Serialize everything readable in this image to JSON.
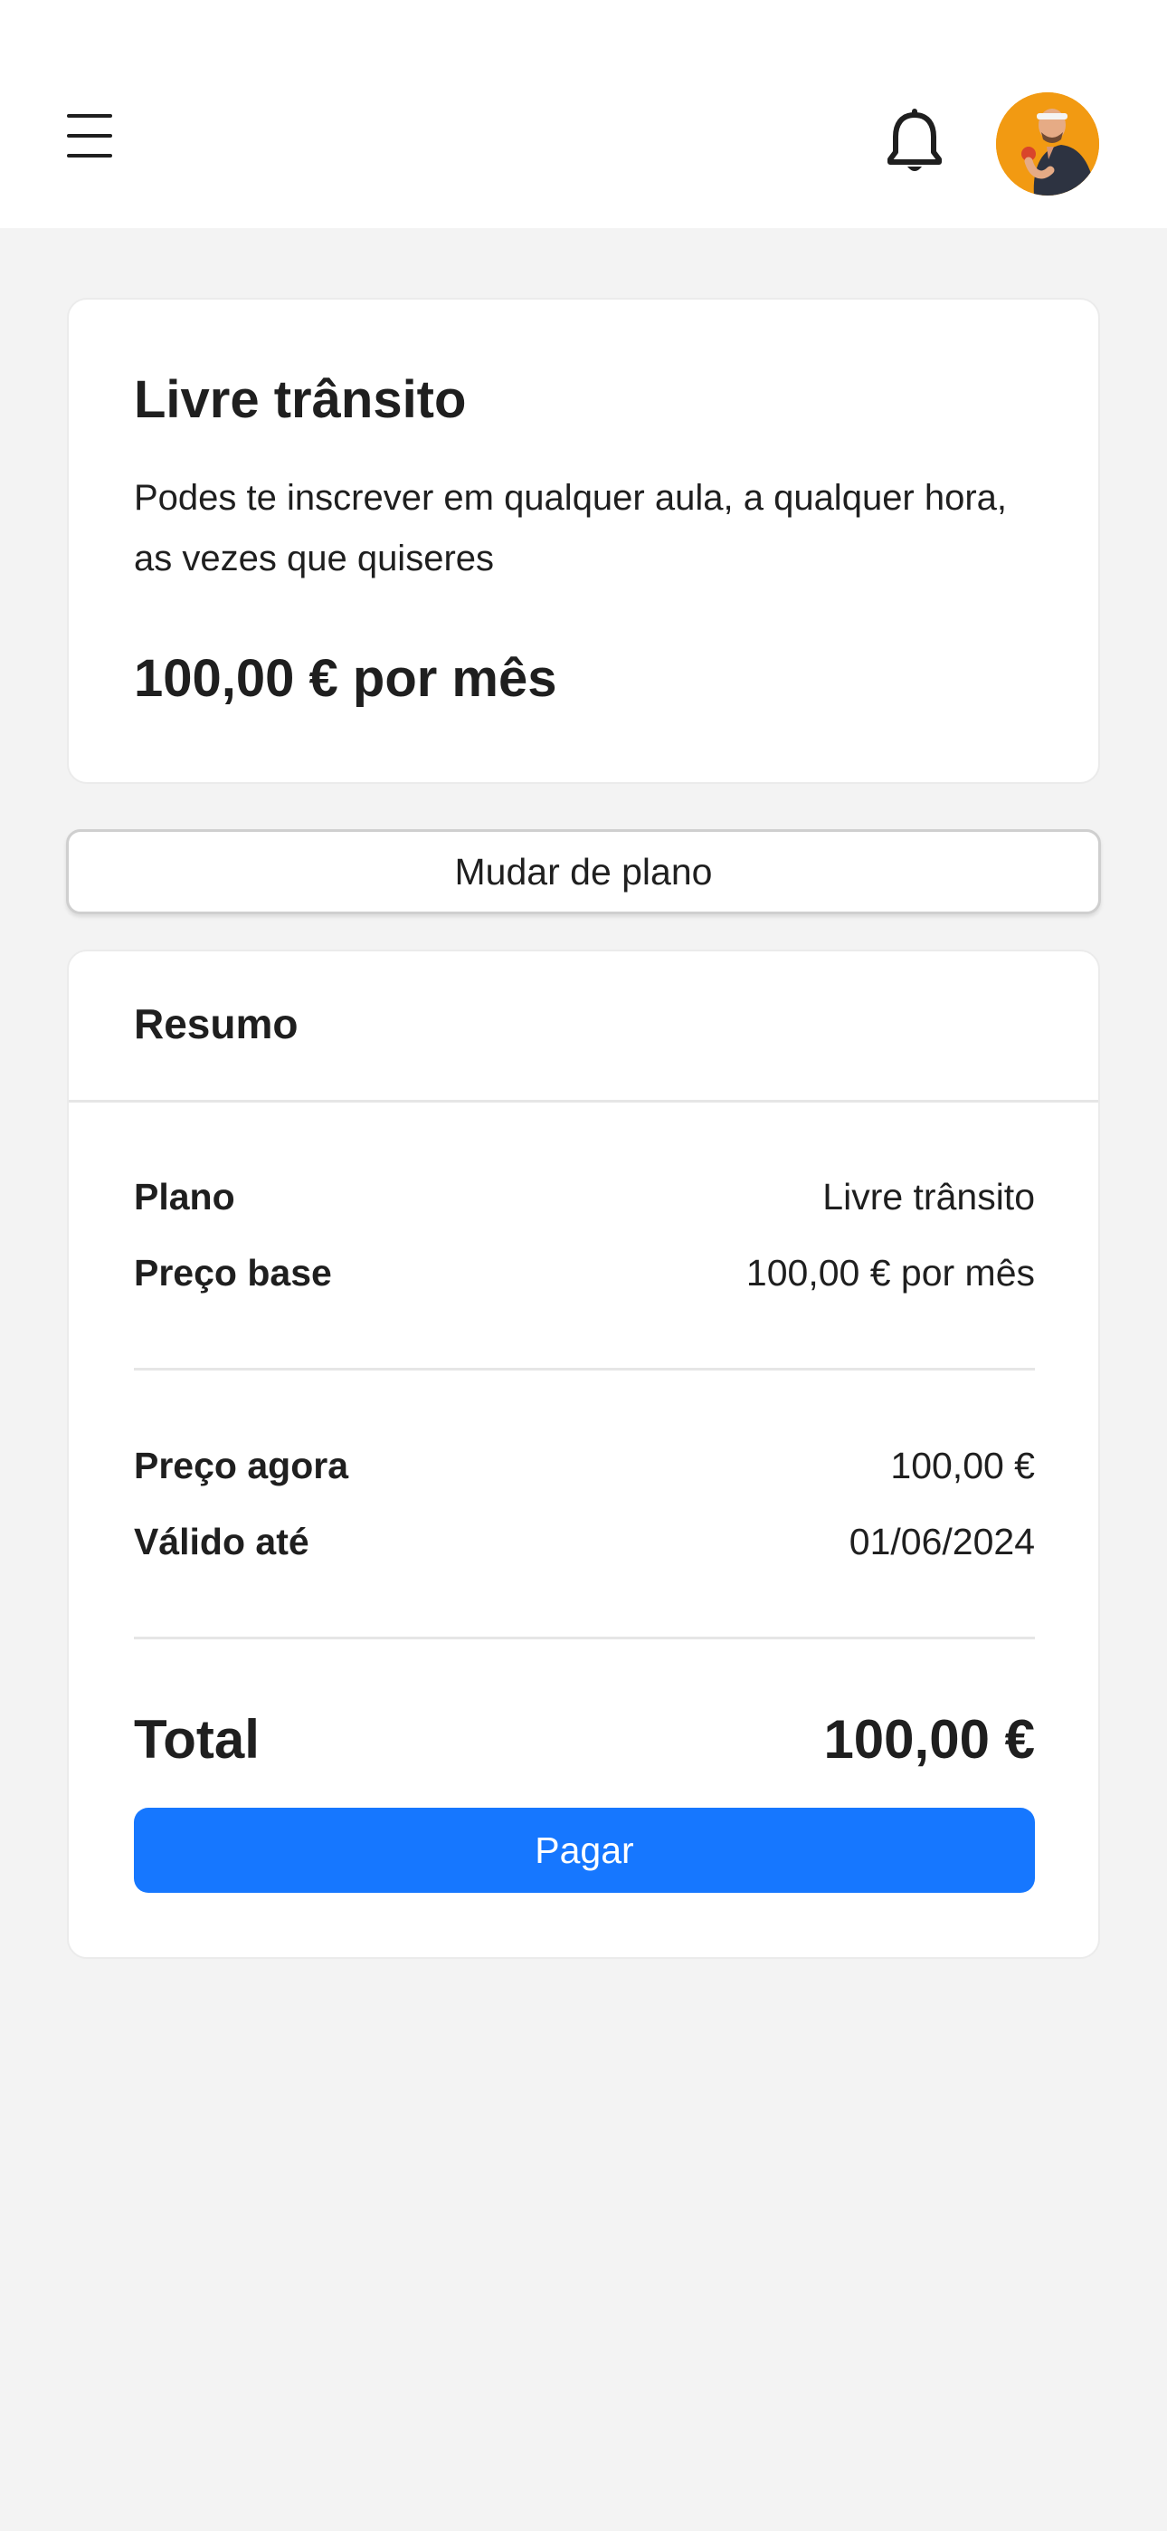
{
  "header": {
    "menu_icon": "hamburger-menu-icon",
    "notification_icon": "bell-icon",
    "avatar_alt": "user-avatar"
  },
  "plan": {
    "title": "Livre trânsito",
    "description": "Podes te inscrever em qualquer aula, a qualquer hora, as vezes que quiseres",
    "price": "100,00 € por mês"
  },
  "change_plan_label": "Mudar de plano",
  "summary": {
    "title": "Resumo",
    "rows": [
      {
        "label": "Plano",
        "value": "Livre trânsito"
      },
      {
        "label": "Preço base",
        "value": "100,00 € por mês"
      },
      {
        "label": "Preço agora",
        "value": "100,00 €"
      },
      {
        "label": "Válido até",
        "value": "01/06/2024"
      }
    ],
    "total_label": "Total",
    "total_value": "100,00 €",
    "pay_label": "Pagar"
  },
  "colors": {
    "accent": "#1677ff",
    "avatar_bg": "#f29a12",
    "page_bg": "#f3f3f3"
  }
}
